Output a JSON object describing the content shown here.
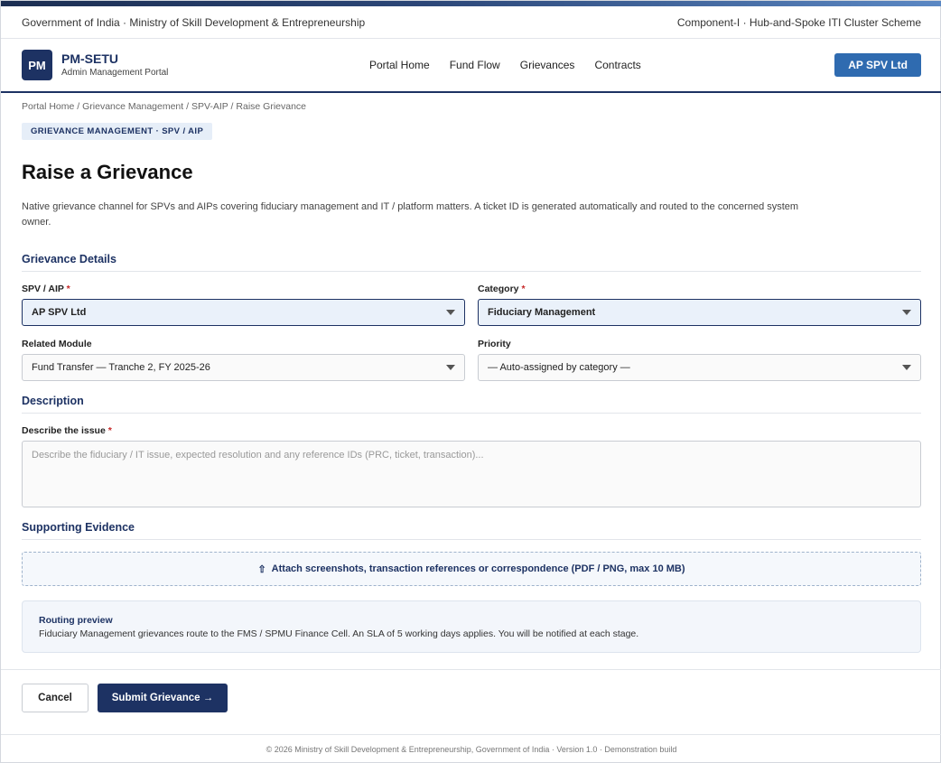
{
  "gov_bar": {
    "left": "Government of India · Ministry of Skill Development & Entrepreneurship",
    "right": "Component-I · Hub-and-Spoke ITI Cluster Scheme"
  },
  "header": {
    "logo_text": "PM",
    "brand_name": "PM-SETU",
    "brand_sub": "Admin Management Portal",
    "nav": [
      "Portal Home",
      "Fund Flow",
      "Grievances",
      "Contracts"
    ],
    "account_label": "AP SPV Ltd"
  },
  "breadcrumb": [
    "Portal Home",
    "Grievance Management",
    "SPV-AIP",
    "Raise Grievance"
  ],
  "breadcrumb_sep": " / ",
  "tag": "GRIEVANCE MANAGEMENT · SPV / AIP",
  "page_title": "Raise a Grievance",
  "intro": "Native grievance channel for SPVs and AIPs covering fiduciary management and IT / platform matters. A ticket ID is generated automatically and routed to the concerned system owner.",
  "sections": {
    "details": "Grievance Details",
    "description": "Description",
    "evidence": "Supporting Evidence"
  },
  "fields": {
    "spv": {
      "label": "SPV / AIP",
      "value": "AP SPV Ltd"
    },
    "category": {
      "label": "Category",
      "value": "Fiduciary Management"
    },
    "module": {
      "label": "Related Module",
      "value": "Fund Transfer — Tranche 2, FY 2025-26"
    },
    "priority": {
      "label": "Priority",
      "value": "— Auto-assigned by category —"
    },
    "issue": {
      "label": "Describe the issue",
      "placeholder": "Describe the fiduciary / IT issue, expected resolution and any reference IDs (PRC, ticket, transaction)..."
    }
  },
  "required_mark": "*",
  "upload": {
    "icon": "⇧",
    "label": "Attach screenshots, transaction references or correspondence (PDF / PNG, max 10 MB)"
  },
  "routing": {
    "title": "Routing preview",
    "text": "Fiduciary Management grievances route to the FMS / SPMU Finance Cell. An SLA of 5 working days applies. You will be notified at each stage."
  },
  "actions": {
    "cancel": "Cancel",
    "submit": "Submit Grievance →"
  },
  "footer": "© 2026 Ministry of Skill Development & Entrepreneurship, Government of India · Version 1.0 · Demonstration build",
  "colors": {
    "primary": "#1d3263",
    "accent": "#2f6bb0",
    "required": "#c62828"
  }
}
